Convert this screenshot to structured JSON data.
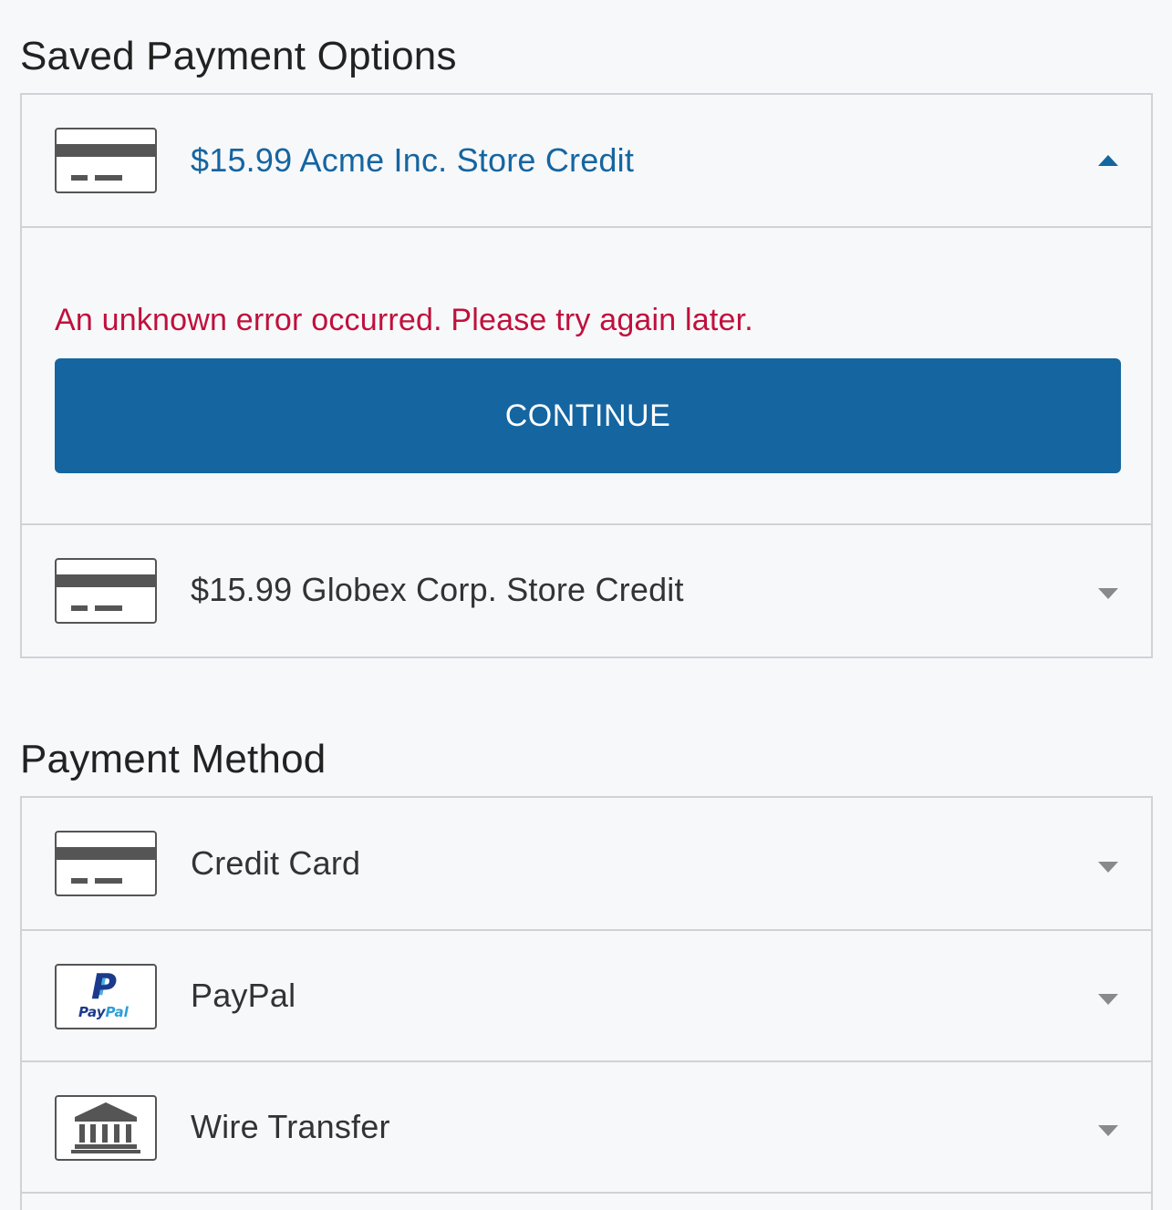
{
  "saved": {
    "title": "Saved Payment Options",
    "items": [
      {
        "label": "$15.99 Acme Inc. Store Credit",
        "icon": "credit-card-icon",
        "expanded": true
      },
      {
        "label": "$15.99 Globex Corp. Store Credit",
        "icon": "credit-card-icon",
        "expanded": false
      }
    ],
    "error": "An unknown error occurred. Please try again later.",
    "continue_label": "CONTINUE"
  },
  "method": {
    "title": "Payment Method",
    "items": [
      {
        "label": "Credit Card",
        "icon": "credit-card-icon"
      },
      {
        "label": "PayPal",
        "icon": "paypal-icon",
        "logo_text": "PayPal"
      },
      {
        "label": "Wire Transfer",
        "icon": "bank-icon"
      }
    ]
  },
  "colors": {
    "accent": "#1565a0",
    "error": "#c0103c",
    "border": "#cfd2d6",
    "background": "#f7f8fa"
  }
}
